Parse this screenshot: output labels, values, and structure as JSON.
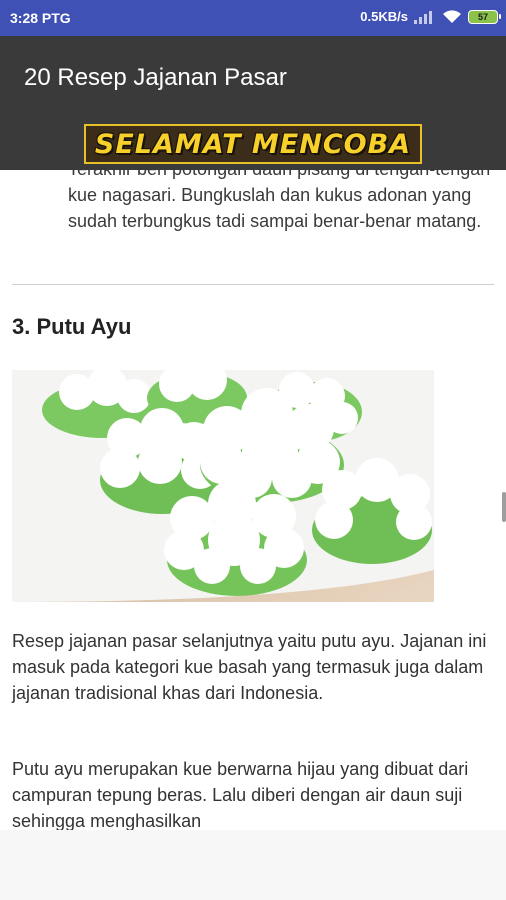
{
  "status_bar": {
    "time": "3:28 PTG",
    "net_speed": "0.5KB/s",
    "battery_level": "57",
    "icons": [
      "signal-icon",
      "wifi-icon",
      "battery-icon"
    ]
  },
  "app_bar": {
    "title": "20 Resep Jajanan Pasar"
  },
  "banner": {
    "text": "SELAMAT MENCOBA"
  },
  "article": {
    "previous_paragraph": "Terakhir beri potongan daun pisang di tengah-tengah kue nagasari. Bungkuslah dan kukus adonan yang sudah terbungkus tadi sampai benar-benar matang.",
    "section_heading": "3. Putu Ayu",
    "paragraphs": [
      "Resep jajanan pasar selanjutnya yaitu putu ayu. Jajanan ini masuk pada kategori kue basah yang termasuk juga dalam jajanan tradisional khas dari Indonesia.",
      "Putu ayu merupakan kue berwarna hijau yang dibuat dari campuran tepung beras. Lalu diberi dengan air daun suji sehingga menghasilkan"
    ]
  },
  "colors": {
    "status_bar": "#3f51b5",
    "app_bar": "#3a3a3a",
    "banner_text": "#f7d12a",
    "cake_green": "#7cc962",
    "coconut": "#ffffff"
  }
}
